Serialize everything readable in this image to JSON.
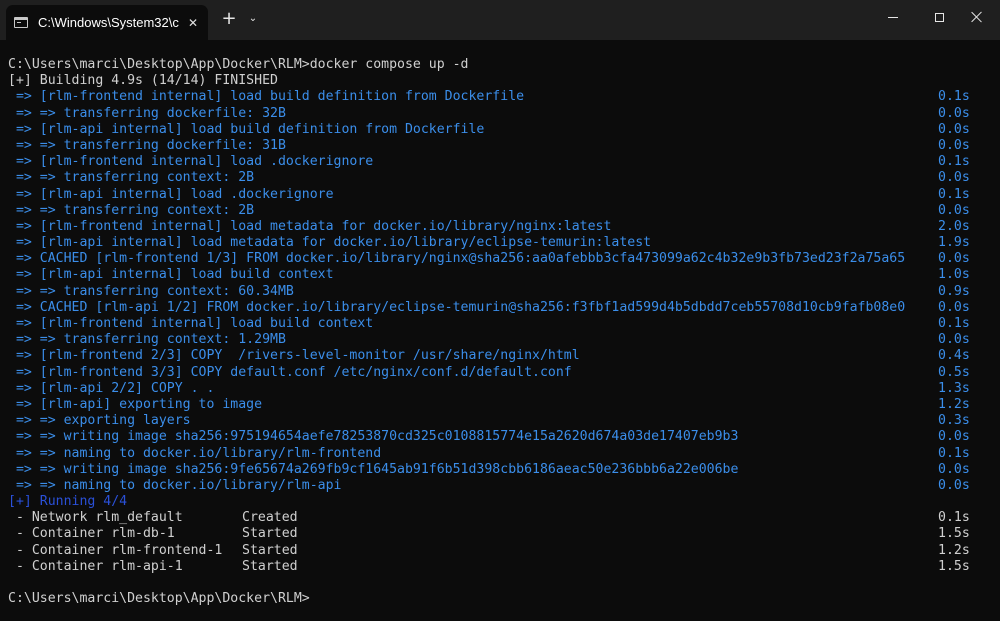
{
  "tab": {
    "title": "C:\\Windows\\System32\\c",
    "close": "✕",
    "new_tab": "+",
    "dropdown": "⌄"
  },
  "terminal": {
    "prompt1": "C:\\Users\\marci\\Desktop\\App\\Docker\\RLM>docker compose up -d",
    "building": "[+] Building 4.9s (14/14) FINISHED",
    "build_steps": [
      {
        "text": " => [rlm-frontend internal] load build definition from Dockerfile",
        "time": "0.1s"
      },
      {
        "text": " => => transferring dockerfile: 32B",
        "time": "0.0s"
      },
      {
        "text": " => [rlm-api internal] load build definition from Dockerfile",
        "time": "0.0s"
      },
      {
        "text": " => => transferring dockerfile: 31B",
        "time": "0.0s"
      },
      {
        "text": " => [rlm-frontend internal] load .dockerignore",
        "time": "0.1s"
      },
      {
        "text": " => => transferring context: 2B",
        "time": "0.0s"
      },
      {
        "text": " => [rlm-api internal] load .dockerignore",
        "time": "0.1s"
      },
      {
        "text": " => => transferring context: 2B",
        "time": "0.0s"
      },
      {
        "text": " => [rlm-frontend internal] load metadata for docker.io/library/nginx:latest",
        "time": "2.0s"
      },
      {
        "text": " => [rlm-api internal] load metadata for docker.io/library/eclipse-temurin:latest",
        "time": "1.9s"
      },
      {
        "text": " => CACHED [rlm-frontend 1/3] FROM docker.io/library/nginx@sha256:aa0afebbb3cfa473099a62c4b32e9b3fb73ed23f2a75a65",
        "time": "0.0s"
      },
      {
        "text": " => [rlm-api internal] load build context",
        "time": "1.0s"
      },
      {
        "text": " => => transferring context: 60.34MB",
        "time": "0.9s"
      },
      {
        "text": " => CACHED [rlm-api 1/2] FROM docker.io/library/eclipse-temurin@sha256:f3fbf1ad599d4b5dbdd7ceb55708d10cb9fafb08e0",
        "time": "0.0s"
      },
      {
        "text": " => [rlm-frontend internal] load build context",
        "time": "0.1s"
      },
      {
        "text": " => => transferring context: 1.29MB",
        "time": "0.0s"
      },
      {
        "text": " => [rlm-frontend 2/3] COPY  /rivers-level-monitor /usr/share/nginx/html",
        "time": "0.4s"
      },
      {
        "text": " => [rlm-frontend 3/3] COPY default.conf /etc/nginx/conf.d/default.conf",
        "time": "0.5s"
      },
      {
        "text": " => [rlm-api 2/2] COPY . .",
        "time": "1.3s"
      },
      {
        "text": " => [rlm-api] exporting to image",
        "time": "1.2s"
      },
      {
        "text": " => => exporting layers",
        "time": "0.3s"
      },
      {
        "text": " => => writing image sha256:975194654aefe78253870cd325c0108815774e15a2620d674a03de17407eb9b3",
        "time": "0.0s"
      },
      {
        "text": " => => naming to docker.io/library/rlm-frontend",
        "time": "0.1s"
      },
      {
        "text": " => => writing image sha256:9fe65674a269fb9cf1645ab91f6b51d398cbb6186aeac50e236bbb6a22e006be",
        "time": "0.0s"
      },
      {
        "text": " => => naming to docker.io/library/rlm-api",
        "time": "0.0s"
      }
    ],
    "running": "[+] Running 4/4",
    "run_items": [
      {
        "text": " - Network rlm_default",
        "status": "Created",
        "time": "0.1s"
      },
      {
        "text": " - Container rlm-db-1",
        "status": "Started",
        "time": "1.5s"
      },
      {
        "text": " - Container rlm-frontend-1",
        "status": "Started",
        "time": "1.2s"
      },
      {
        "text": " - Container rlm-api-1",
        "status": "Started",
        "time": "1.5s"
      }
    ],
    "prompt2": "C:\\Users\\marci\\Desktop\\App\\Docker\\RLM>"
  }
}
